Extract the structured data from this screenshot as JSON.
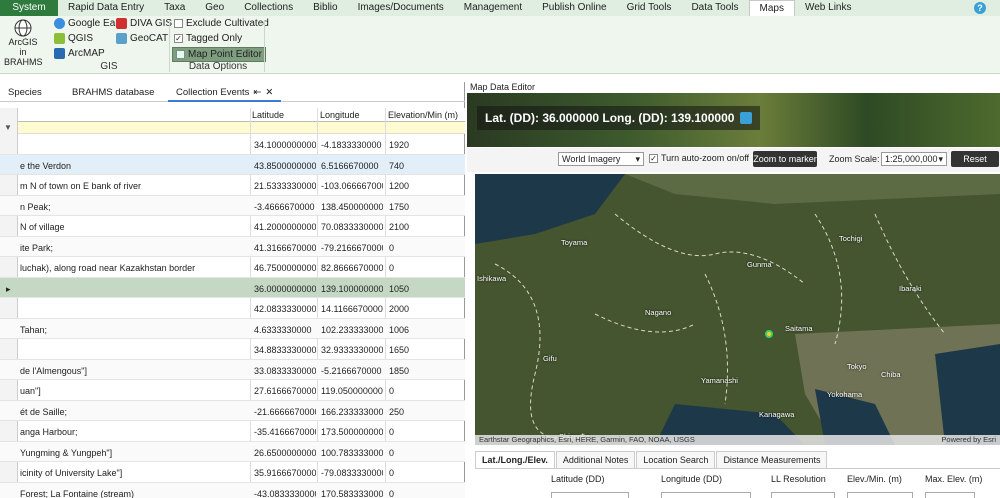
{
  "menubar": {
    "items": [
      "System",
      "Rapid Data Entry",
      "Taxa",
      "Geo",
      "Collections",
      "Biblio",
      "Images/Documents",
      "Management",
      "Publish Online",
      "Grid Tools",
      "Data Tools",
      "Maps",
      "Web Links"
    ],
    "active": "Maps",
    "help_label": "?"
  },
  "ribbon": {
    "arcgis_label_1": "ArcGIS in",
    "arcgis_label_2": "BRAHMS",
    "gis_items": [
      "Google Earth",
      "DIVA GIS",
      "QGIS",
      "GeoCAT",
      "ArcMAP"
    ],
    "gis_group_label": "GIS",
    "options": {
      "exclude_cultivated": "Exclude Cultivated",
      "tagged_only": "Tagged Only",
      "map_point_editor": "Map Point Editor",
      "exclude_checked": false,
      "tagged_checked": true
    },
    "options_group_label": "Data Options"
  },
  "left_tabs": [
    "Species",
    "BRAHMS database",
    "Collection Events"
  ],
  "tab_pin_glyph": "⇤",
  "tab_close_glyph": "✕",
  "grid": {
    "filter_icon": "▼",
    "row_pointer": "▸",
    "columns": [
      "",
      "Latitude",
      "Longitude",
      "Elevation/Min (m)"
    ],
    "rows": [
      {
        "locality": "",
        "lat": "34.1000000000",
        "lon": "-4.1833330000",
        "elev": "1920"
      },
      {
        "locality": "e the Verdon",
        "lat": "43.8500000000",
        "lon": "6.5166670000",
        "elev": "740"
      },
      {
        "locality": "m N of town on E bank of river",
        "lat": "21.5333330000",
        "lon": "-103.0666670000",
        "elev": "1200"
      },
      {
        "locality": "n Peak;",
        "lat": "-3.4666670000",
        "lon": "138.4500000000",
        "elev": "1750"
      },
      {
        "locality": "N of village",
        "lat": "41.2000000000",
        "lon": "70.0833330000",
        "elev": "2100"
      },
      {
        "locality": "ite Park;",
        "lat": "41.3166670000",
        "lon": "-79.2166670000",
        "elev": "0"
      },
      {
        "locality": "luchak), along road near Kazakhstan border",
        "lat": "46.7500000000",
        "lon": "82.8666670000",
        "elev": "0"
      },
      {
        "locality": "",
        "lat": "36.0000000000",
        "lon": "139.1000000000",
        "elev": "1050"
      },
      {
        "locality": "",
        "lat": "42.0833330000",
        "lon": "14.1166670000",
        "elev": "2000"
      },
      {
        "locality": "Tahan;",
        "lat": "4.6333330000",
        "lon": "102.2333330000",
        "elev": "1006"
      },
      {
        "locality": "",
        "lat": "34.8833330000",
        "lon": "32.9333330000",
        "elev": "1650"
      },
      {
        "locality": "de l'Almengous\"]",
        "lat": "33.0833330000",
        "lon": "-5.2166670000",
        "elev": "1850"
      },
      {
        "locality": "uan\"]",
        "lat": "27.6166670000",
        "lon": "119.0500000000",
        "elev": "0"
      },
      {
        "locality": "ét de Saille;",
        "lat": "-21.6666670000",
        "lon": "166.2333330000",
        "elev": "250"
      },
      {
        "locality": "anga Harbour;",
        "lat": "-35.4166670000",
        "lon": "173.5000000000",
        "elev": "0"
      },
      {
        "locality": "Yungming & Yungpeh\"]",
        "lat": "26.6500000000",
        "lon": "100.7833330000",
        "elev": "0"
      },
      {
        "locality": "icinity of University Lake\"]",
        "lat": "35.9166670000",
        "lon": "-79.0833330000",
        "elev": "0"
      },
      {
        "locality": "Forest; La Fontaine (stream)",
        "lat": "-43.0833330000",
        "lon": "170.5833330000",
        "elev": "0"
      }
    ]
  },
  "map_editor": {
    "title": "Map Data Editor",
    "coords_text": "Lat. (DD): 36.000000 Long. (DD): 139.100000",
    "imagery": "World Imagery",
    "auto_zoom_label": "Turn auto-zoom on/off",
    "auto_zoom_checked": true,
    "zoom_to_marker": "Zoom to marker",
    "zoom_scale_label": "Zoom Scale:",
    "zoom_scale": "1:25,000,000",
    "reset_zoom": "Reset zoom",
    "place_labels": [
      "Toyama",
      "Tochigi",
      "Gunma",
      "Ibaraki",
      "Ishikawa",
      "Nagano",
      "Saitama",
      "Gifu",
      "Tokyo",
      "Chiba",
      "Yamanashi",
      "Yokohama",
      "Kanagawa",
      "Shizuoka"
    ],
    "attribution": "Earthstar Geographics, Esri, HERE, Garmin, FAO, NOAA, USGS",
    "powered_by": "Powered by Esri",
    "detail_tabs": [
      "Lat./Long./Elev.",
      "Additional Notes",
      "Location Search",
      "Distance Measurements"
    ],
    "detail_headers": [
      "Latitude (DD)",
      "Longitude (DD)",
      "LL Resolution",
      "Elev./Min. (m)",
      "Max. Elev. (m)"
    ]
  },
  "colors": {
    "brand": "#2f7a3d",
    "selected_row": "#c4d8c4",
    "accent": "#3aa0d8"
  }
}
